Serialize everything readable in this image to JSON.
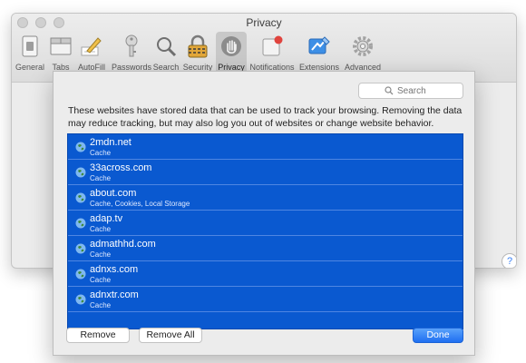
{
  "window": {
    "title": "Privacy"
  },
  "toolbar": {
    "items": [
      {
        "label": "General",
        "icon": "switch-icon"
      },
      {
        "label": "Tabs",
        "icon": "tabs-icon"
      },
      {
        "label": "AutoFill",
        "icon": "pencil-icon"
      },
      {
        "label": "Passwords",
        "icon": "key-icon"
      },
      {
        "label": "Search",
        "icon": "magnifier-icon"
      },
      {
        "label": "Security",
        "icon": "lock-icon"
      },
      {
        "label": "Privacy",
        "icon": "hand-icon",
        "selected": true
      },
      {
        "label": "Notifications",
        "icon": "notifications-icon"
      },
      {
        "label": "Extensions",
        "icon": "puzzle-icon"
      },
      {
        "label": "Advanced",
        "icon": "gear-icon"
      }
    ]
  },
  "help": {
    "label": "?"
  },
  "sheet": {
    "search_placeholder": "Search",
    "description": "These websites have stored data that can be used to track your browsing. Removing the data may reduce tracking, but may also log you out of websites or change website behavior.",
    "sites": [
      {
        "name": "2mdn.net",
        "data": "Cache"
      },
      {
        "name": "33across.com",
        "data": "Cache"
      },
      {
        "name": "about.com",
        "data": "Cache, Cookies, Local Storage"
      },
      {
        "name": "adap.tv",
        "data": "Cache"
      },
      {
        "name": "admathhd.com",
        "data": "Cache"
      },
      {
        "name": "adnxs.com",
        "data": "Cache"
      },
      {
        "name": "adnxtr.com",
        "data": "Cache"
      }
    ],
    "remove_label": "Remove",
    "remove_all_label": "Remove All",
    "done_label": "Done"
  },
  "colors": {
    "selection": "#0a59d0",
    "accent": "#1f6ff1"
  }
}
